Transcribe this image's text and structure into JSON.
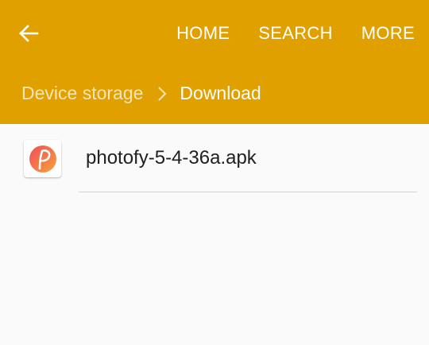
{
  "header": {
    "back_icon": "arrow-left-icon",
    "actions": [
      {
        "label": "HOME"
      },
      {
        "label": "SEARCH"
      },
      {
        "label": "MORE"
      }
    ],
    "breadcrumb": {
      "root": "Device storage",
      "separator_icon": "chevron-right-icon",
      "current": "Download"
    },
    "colors": {
      "background": "#e0a000",
      "text": "#ffffff"
    }
  },
  "files": [
    {
      "name": "photofy-5-4-36a.apk",
      "icon": "photofy-app-icon"
    }
  ]
}
